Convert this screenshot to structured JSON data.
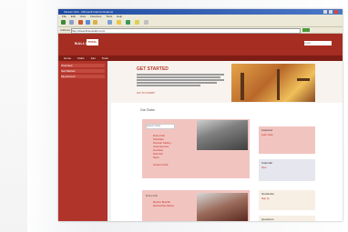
{
  "browser": {
    "title": "Fitness Club - Microsoft Internet Explorer",
    "menu": [
      "File",
      "Edit",
      "View",
      "Favorites",
      "Tools",
      "Help"
    ],
    "address_label": "Address",
    "address_value": "http://www.fitnessclub.com/"
  },
  "site": {
    "logo_prefix": "BALLY",
    "logo_box": "TOTAL",
    "login_placeholder": "Login",
    "nav": [
      "Home",
      "Clubs",
      "Join",
      "Tools"
    ],
    "sidebar": [
      "Overview",
      "Get Started",
      "My Account"
    ],
    "hero_title": "GET STARTED",
    "hero_link": "GO TO START",
    "section_title": "Our Clubs",
    "card1_input": "Search Clubs",
    "card1_links": [
      "Find a Club",
      "Schedules",
      "Personal Training",
      "Group Exercise",
      "Amenities",
      "Kids Club",
      "Hours",
      "Contact a Club"
    ],
    "card2_title": "Find a Club",
    "card2_links": [
      "Member Benefits",
      "Membership Options"
    ],
    "right_cards": [
      {
        "title": "Featured",
        "link": "Learn more",
        "bg": "#f2c4c0"
      },
      {
        "title": "Calendar",
        "link": "View",
        "bg": "#e6e6ee"
      },
      {
        "title": "Newsletter",
        "link": "Sign up",
        "bg": "#f7efe4"
      },
      {
        "title": "Questions",
        "link": "",
        "bg": "#f7efe4"
      }
    ]
  }
}
